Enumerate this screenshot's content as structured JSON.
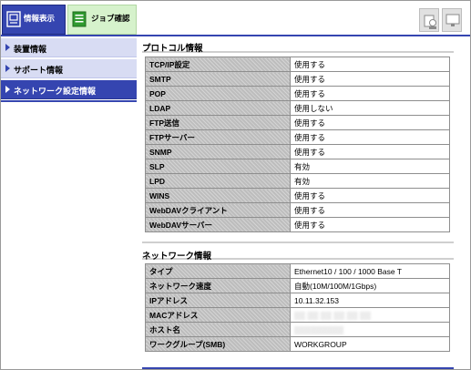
{
  "tabs": {
    "info": {
      "label": "情報表示",
      "icon": "info-display-icon"
    },
    "job": {
      "label": "ジョブ確認",
      "icon": "job-document-icon"
    }
  },
  "toolbar": [
    {
      "icon": "copy-user-icon"
    },
    {
      "icon": "display-icon"
    }
  ],
  "sidebar": {
    "items": [
      {
        "label": "装置情報",
        "active": false
      },
      {
        "label": "サポート情報",
        "active": false
      },
      {
        "label": "ネットワーク設定情報",
        "active": true
      }
    ]
  },
  "protocol": {
    "title": "プロトコル情報",
    "rows": [
      {
        "key": "TCP/IP設定",
        "value": "使用する"
      },
      {
        "key": "SMTP",
        "value": "使用する"
      },
      {
        "key": "POP",
        "value": "使用する"
      },
      {
        "key": "LDAP",
        "value": "使用しない"
      },
      {
        "key": "FTP送信",
        "value": "使用する"
      },
      {
        "key": "FTPサーバー",
        "value": "使用する"
      },
      {
        "key": "SNMP",
        "value": "使用する"
      },
      {
        "key": "SLP",
        "value": "有効"
      },
      {
        "key": "LPD",
        "value": "有効"
      },
      {
        "key": "WINS",
        "value": "使用する"
      },
      {
        "key": "WebDAVクライアント",
        "value": "使用する"
      },
      {
        "key": "WebDAVサーバー",
        "value": "使用する"
      }
    ]
  },
  "network": {
    "title": "ネットワーク情報",
    "rows": [
      {
        "key": "タイプ",
        "value": "Ethernet10 / 100 / 1000 Base T"
      },
      {
        "key": "ネットワーク速度",
        "value": "自動(10M/100M/1Gbps)"
      },
      {
        "key": "IPアドレス",
        "value": "10.11.32.153"
      },
      {
        "key": "MACアドレス",
        "value": "",
        "obscured": true
      },
      {
        "key": "ホスト名",
        "value": "",
        "obscured": true
      },
      {
        "key": "ワークグループ(SMB)",
        "value": "WORKGROUP"
      }
    ]
  },
  "colors": {
    "accent": "#3545b0",
    "sidebar_bg": "#d8dcf3",
    "job_tab_bg": "#d6f2cc",
    "key_cell_bg": "#bdbdbd"
  }
}
